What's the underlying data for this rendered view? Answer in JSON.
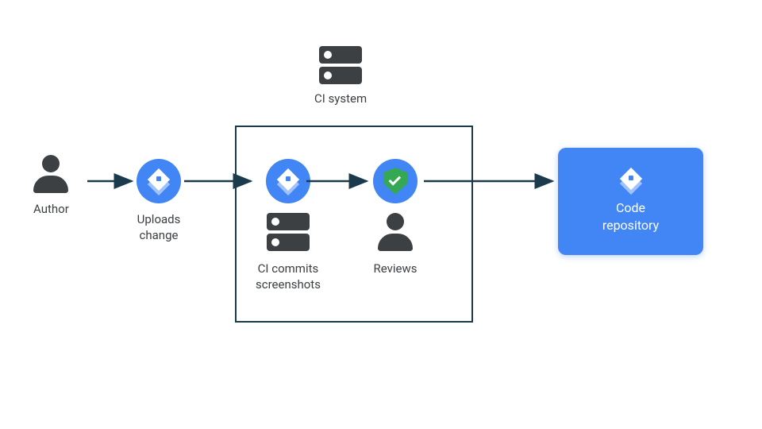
{
  "nodes": {
    "author": {
      "label": "Author"
    },
    "uploads": {
      "label": "Uploads\nchange"
    },
    "ci_system": {
      "label": "CI system"
    },
    "ci_commits": {
      "label": "CI commits\nscreenshots"
    },
    "reviews": {
      "label": "Reviews"
    },
    "repo": {
      "label": "Code\nrepository"
    }
  },
  "icons": {
    "author": "person-icon",
    "uploads": "layers-icon",
    "ci_system": "servers-icon",
    "ci_commits_main": "layers-icon",
    "ci_commits_sub": "servers-icon",
    "reviews_main": "shield-check-icon",
    "reviews_sub": "person-icon",
    "repo": "layers-icon"
  },
  "colors": {
    "accent": "#4285f4",
    "success": "#34a853",
    "ink": "#3c4043",
    "stroke": "#1b3a4b"
  },
  "flow": [
    "author",
    "uploads",
    "ci_commits",
    "reviews",
    "repo"
  ]
}
